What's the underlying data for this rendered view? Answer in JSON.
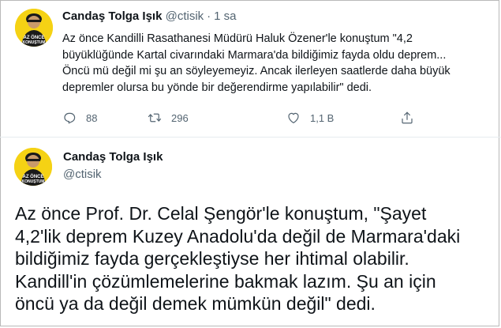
{
  "tweets": [
    {
      "author": "Candaş Tolga Işık",
      "handle": "@ctisik",
      "time": "1 sa",
      "text": "Az önce Kandilli Rasathanesi Müdürü Haluk Özener'le konuştum \"4,2\nbüyüklüğünde Kartal civarındaki Marmara'da bildiğimiz fayda oldu deprem...\nÖncü mü değil mi şu an söyleyemeyiz. Ancak ilerleyen saatlerde daha büyük\ndepremler olursa bu yönde bir değerendirme yapılabilir\" dedi.",
      "replies": "88",
      "retweets": "296",
      "likes": "1,1 B"
    },
    {
      "author": "Candaş Tolga Işık",
      "handle": "@ctisik",
      "text": "Az önce Prof. Dr. Celal Şengör'le konuştum, \"Şayet\n4,2'lik deprem Kuzey Anadolu'da değil de Marmara'daki\nbildiğimiz fayda gerçekleştiyse her ihtimal olabilir.\nKandill'in çözümlemelerine bakmak lazım. Şu an için\nöncü ya da değil demek mümkün değil\" dedi."
    }
  ],
  "icons": {
    "reply": "reply-icon",
    "retweet": "retweet-icon",
    "like": "heart-icon",
    "share": "share-icon"
  },
  "colors": {
    "avatar_bg": "#f5d214",
    "muted_text": "#536471",
    "primary_text": "#0f1419"
  }
}
